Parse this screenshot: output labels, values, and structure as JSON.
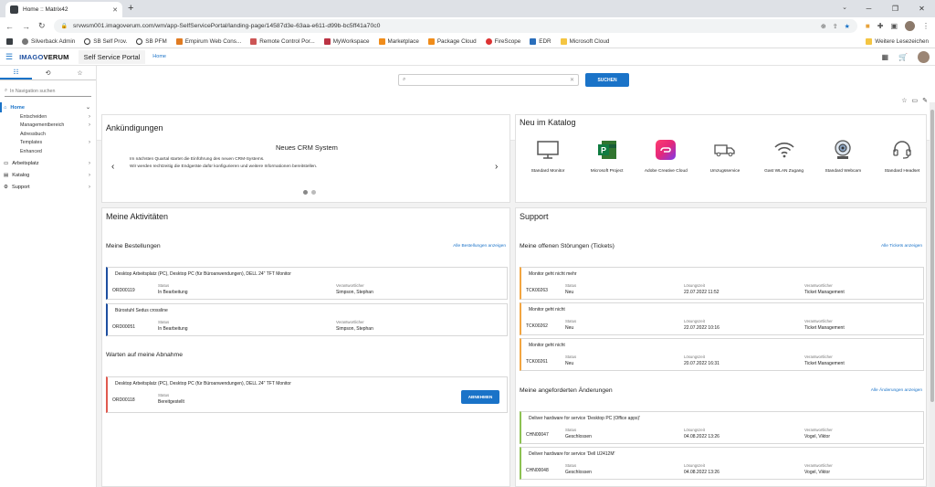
{
  "browser": {
    "tab_title": "Home :: Matrix42",
    "url": "srvwsm001.imagoverum.com/wm/app-SelfServicePortal/landing-page/14587d3e-63aa-e611-d99b-bc5ff41a70c0",
    "bookmarks": [
      "Silverback Admin",
      "SB Self Prov.",
      "SB PFM",
      "Empirum Web Cons...",
      "Remote Control Por...",
      "MyWorkspace",
      "Marketplace",
      "Package Cloud",
      "FireScope",
      "EDR",
      "Microsoft Cloud"
    ],
    "bookmarks_right": "Weitere Lesezeichen"
  },
  "app": {
    "logo_a": "IMAGO",
    "logo_b": "VERUM",
    "portal": "Self Service Portal",
    "breadcrumb": "Home"
  },
  "sidebar": {
    "search_placeholder": "In Navigation suchen",
    "home": "Home",
    "sub": [
      "Entscheiden",
      "Managementbereich",
      "Adressbuch",
      "Templates",
      "Enhanced"
    ],
    "items": [
      "Arbeitsplatz",
      "Katalog",
      "Support"
    ]
  },
  "search": {
    "button": "SUCHEN"
  },
  "announcements": {
    "title": "Ankündigungen",
    "item_title": "Neues CRM System",
    "line1": "Im nächsten Quartal startet die Einführung des neuen CRM-Systems.",
    "line2": "Wir werden rechtzeitig die Endgeräte dafür konfigurieren und weitere Informationen bereitstellen."
  },
  "catalog": {
    "title": "Neu im Katalog",
    "items": [
      "Standard Monitor",
      "Microsoft Project",
      "Adobe Creative Cloud",
      "Umzugsservice",
      "Gast WLAN Zugang",
      "Standard Webcam",
      "Standard Headset"
    ]
  },
  "activities": {
    "title": "Meine Aktivitäten",
    "orders_title": "Meine Bestellungen",
    "orders_link": "Alle Bestellungen anzeigen",
    "label_status": "Status",
    "label_resp": "Verantwortlicher",
    "label_solution": "Lösungszeit",
    "orders": [
      {
        "title": "Desktop Arbeitsplatz (PC), Desktop PC (für Büroanwendungen), DELL 24\" TFT Monitor",
        "id": "ORD00119",
        "status": "In Bearbeitung",
        "resp": "Simpson, Stephan"
      },
      {
        "title": "Bürostuhl Sedus crossline",
        "id": "ORD00051",
        "status": "In Bearbeitung",
        "resp": "Simpson, Stephan"
      }
    ],
    "approval_title": "Warten auf meine Abnahme",
    "approval": {
      "title": "Desktop Arbeitsplatz (PC), Desktop PC (für Büroanwendungen), DELL 24\" TFT Monitor",
      "id": "ORD00118",
      "status": "Bereitgestellt",
      "button": "ABNEHMEN"
    }
  },
  "support": {
    "title": "Support",
    "tickets_title": "Meine offenen Störungen (Tickets)",
    "tickets_link": "Alle Tickets anzeigen",
    "tickets": [
      {
        "title": "Monitor geht nicht mehr",
        "id": "TCK00263",
        "status": "Neu",
        "time": "22.07.2022 11:52",
        "resp": "Ticket Management"
      },
      {
        "title": "Monitor geht nicht",
        "id": "TCK00262",
        "status": "Neu",
        "time": "22.07.2022 10:16",
        "resp": "Ticket Management"
      },
      {
        "title": "Monitor geht nicht",
        "id": "TCK00261",
        "status": "Neu",
        "time": "20.07.2022 16:31",
        "resp": "Ticket Management"
      }
    ],
    "changes_title": "Meine angeforderten Änderungen",
    "changes_link": "Alle Änderungen anzeigen",
    "changes": [
      {
        "title": "Deliver hardware for service 'Desktop PC (Office apps)'",
        "id": "CHN00047",
        "status": "Geschlossen",
        "time": "04.08.2022 13:26",
        "resp": "Vogel, Viktor"
      },
      {
        "title": "Deliver hardware for service 'Dell U2412M'",
        "id": "CHN00048",
        "status": "Geschlossen",
        "time": "04.08.2022 13:26",
        "resp": "Vogel, Viktor"
      }
    ]
  }
}
